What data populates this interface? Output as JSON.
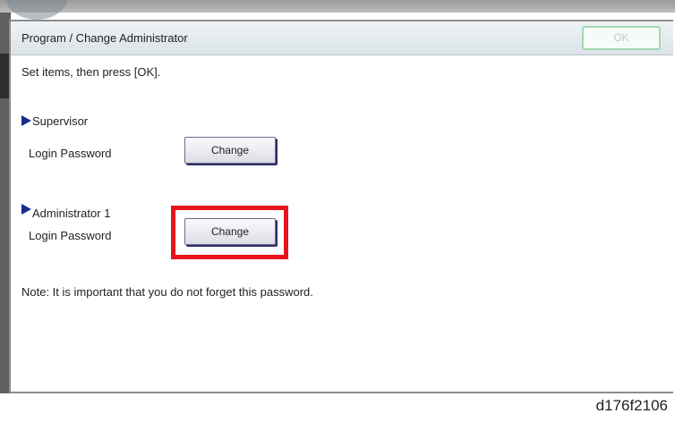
{
  "window": {
    "title": "Program / Change Administrator",
    "ok_label": "OK"
  },
  "instruction": "Set items, then press [OK].",
  "sections": [
    {
      "heading": "Supervisor",
      "row_label": "Login Password",
      "button_label": "Change",
      "highlighted": false
    },
    {
      "heading": "Administrator 1",
      "row_label": "Login Password",
      "button_label": "Change",
      "highlighted": true
    }
  ],
  "note": "Note: It is important that you do not forget this password.",
  "figure_caption": "d176f2106",
  "colors": {
    "highlight": "#e8141c",
    "ok_border": "#a3d9b1",
    "arrow": "#1b2a8c"
  },
  "icons": {
    "section_marker": "right-triangle-icon"
  }
}
